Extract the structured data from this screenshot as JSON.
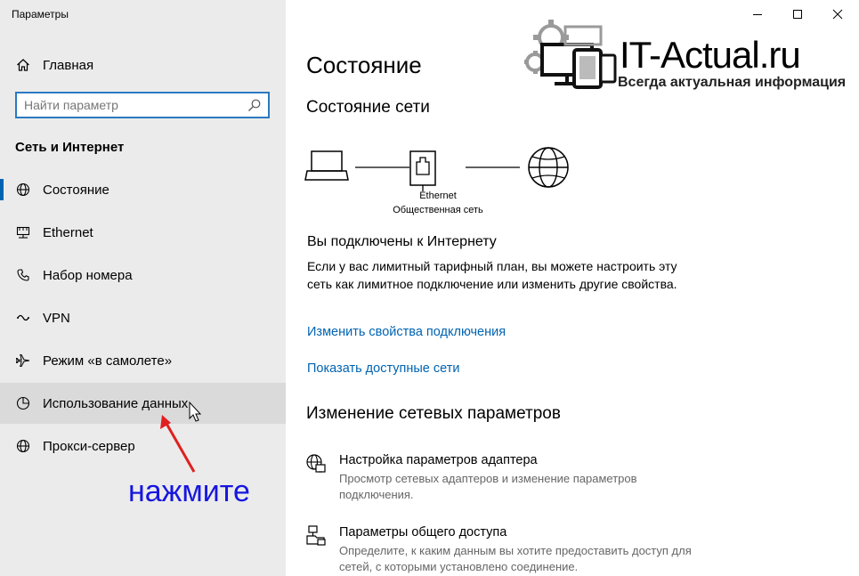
{
  "window": {
    "title": "Параметры"
  },
  "sidebar": {
    "home_label": "Главная",
    "search_placeholder": "Найти параметр",
    "section_title": "Сеть и Интернет",
    "items": [
      {
        "label": "Состояние",
        "icon": "globe-icon"
      },
      {
        "label": "Ethernet",
        "icon": "ethernet-icon"
      },
      {
        "label": "Набор номера",
        "icon": "phone-icon"
      },
      {
        "label": "VPN",
        "icon": "vpn-icon"
      },
      {
        "label": "Режим «в самолете»",
        "icon": "airplane-icon"
      },
      {
        "label": "Использование данных",
        "icon": "pie-chart-icon"
      },
      {
        "label": "Прокси-сервер",
        "icon": "globe-icon"
      }
    ]
  },
  "main": {
    "title": "Состояние",
    "network_status_heading": "Состояние сети",
    "network": {
      "adapter_name": "Ethernet",
      "network_type": "Общественная сеть"
    },
    "connected_title": "Вы подключены к Интернету",
    "connected_desc": "Если у вас лимитный тарифный план, вы можете настроить эту сеть как лимитное подключение или изменить другие свойства.",
    "link_change_properties": "Изменить свойства подключения",
    "link_show_networks": "Показать доступные сети",
    "change_settings_heading": "Изменение сетевых параметров",
    "options": [
      {
        "title": "Настройка параметров адаптера",
        "desc": "Просмотр сетевых адаптеров и изменение параметров подключения."
      },
      {
        "title": "Параметры общего доступа",
        "desc": "Определите, к каким данным вы хотите предоставить доступ для сетей, с которыми установлено соединение."
      }
    ]
  },
  "watermark": {
    "brand": "IT-Actual.ru",
    "tagline": "Всегда актуальная информация"
  },
  "annotation": {
    "text": "нажмите",
    "color": "#1616e0",
    "arrow_color": "#e02020"
  },
  "colors": {
    "accent": "#0063b1",
    "sidebar_bg": "#ebebeb",
    "hover_bg": "#dadada"
  }
}
